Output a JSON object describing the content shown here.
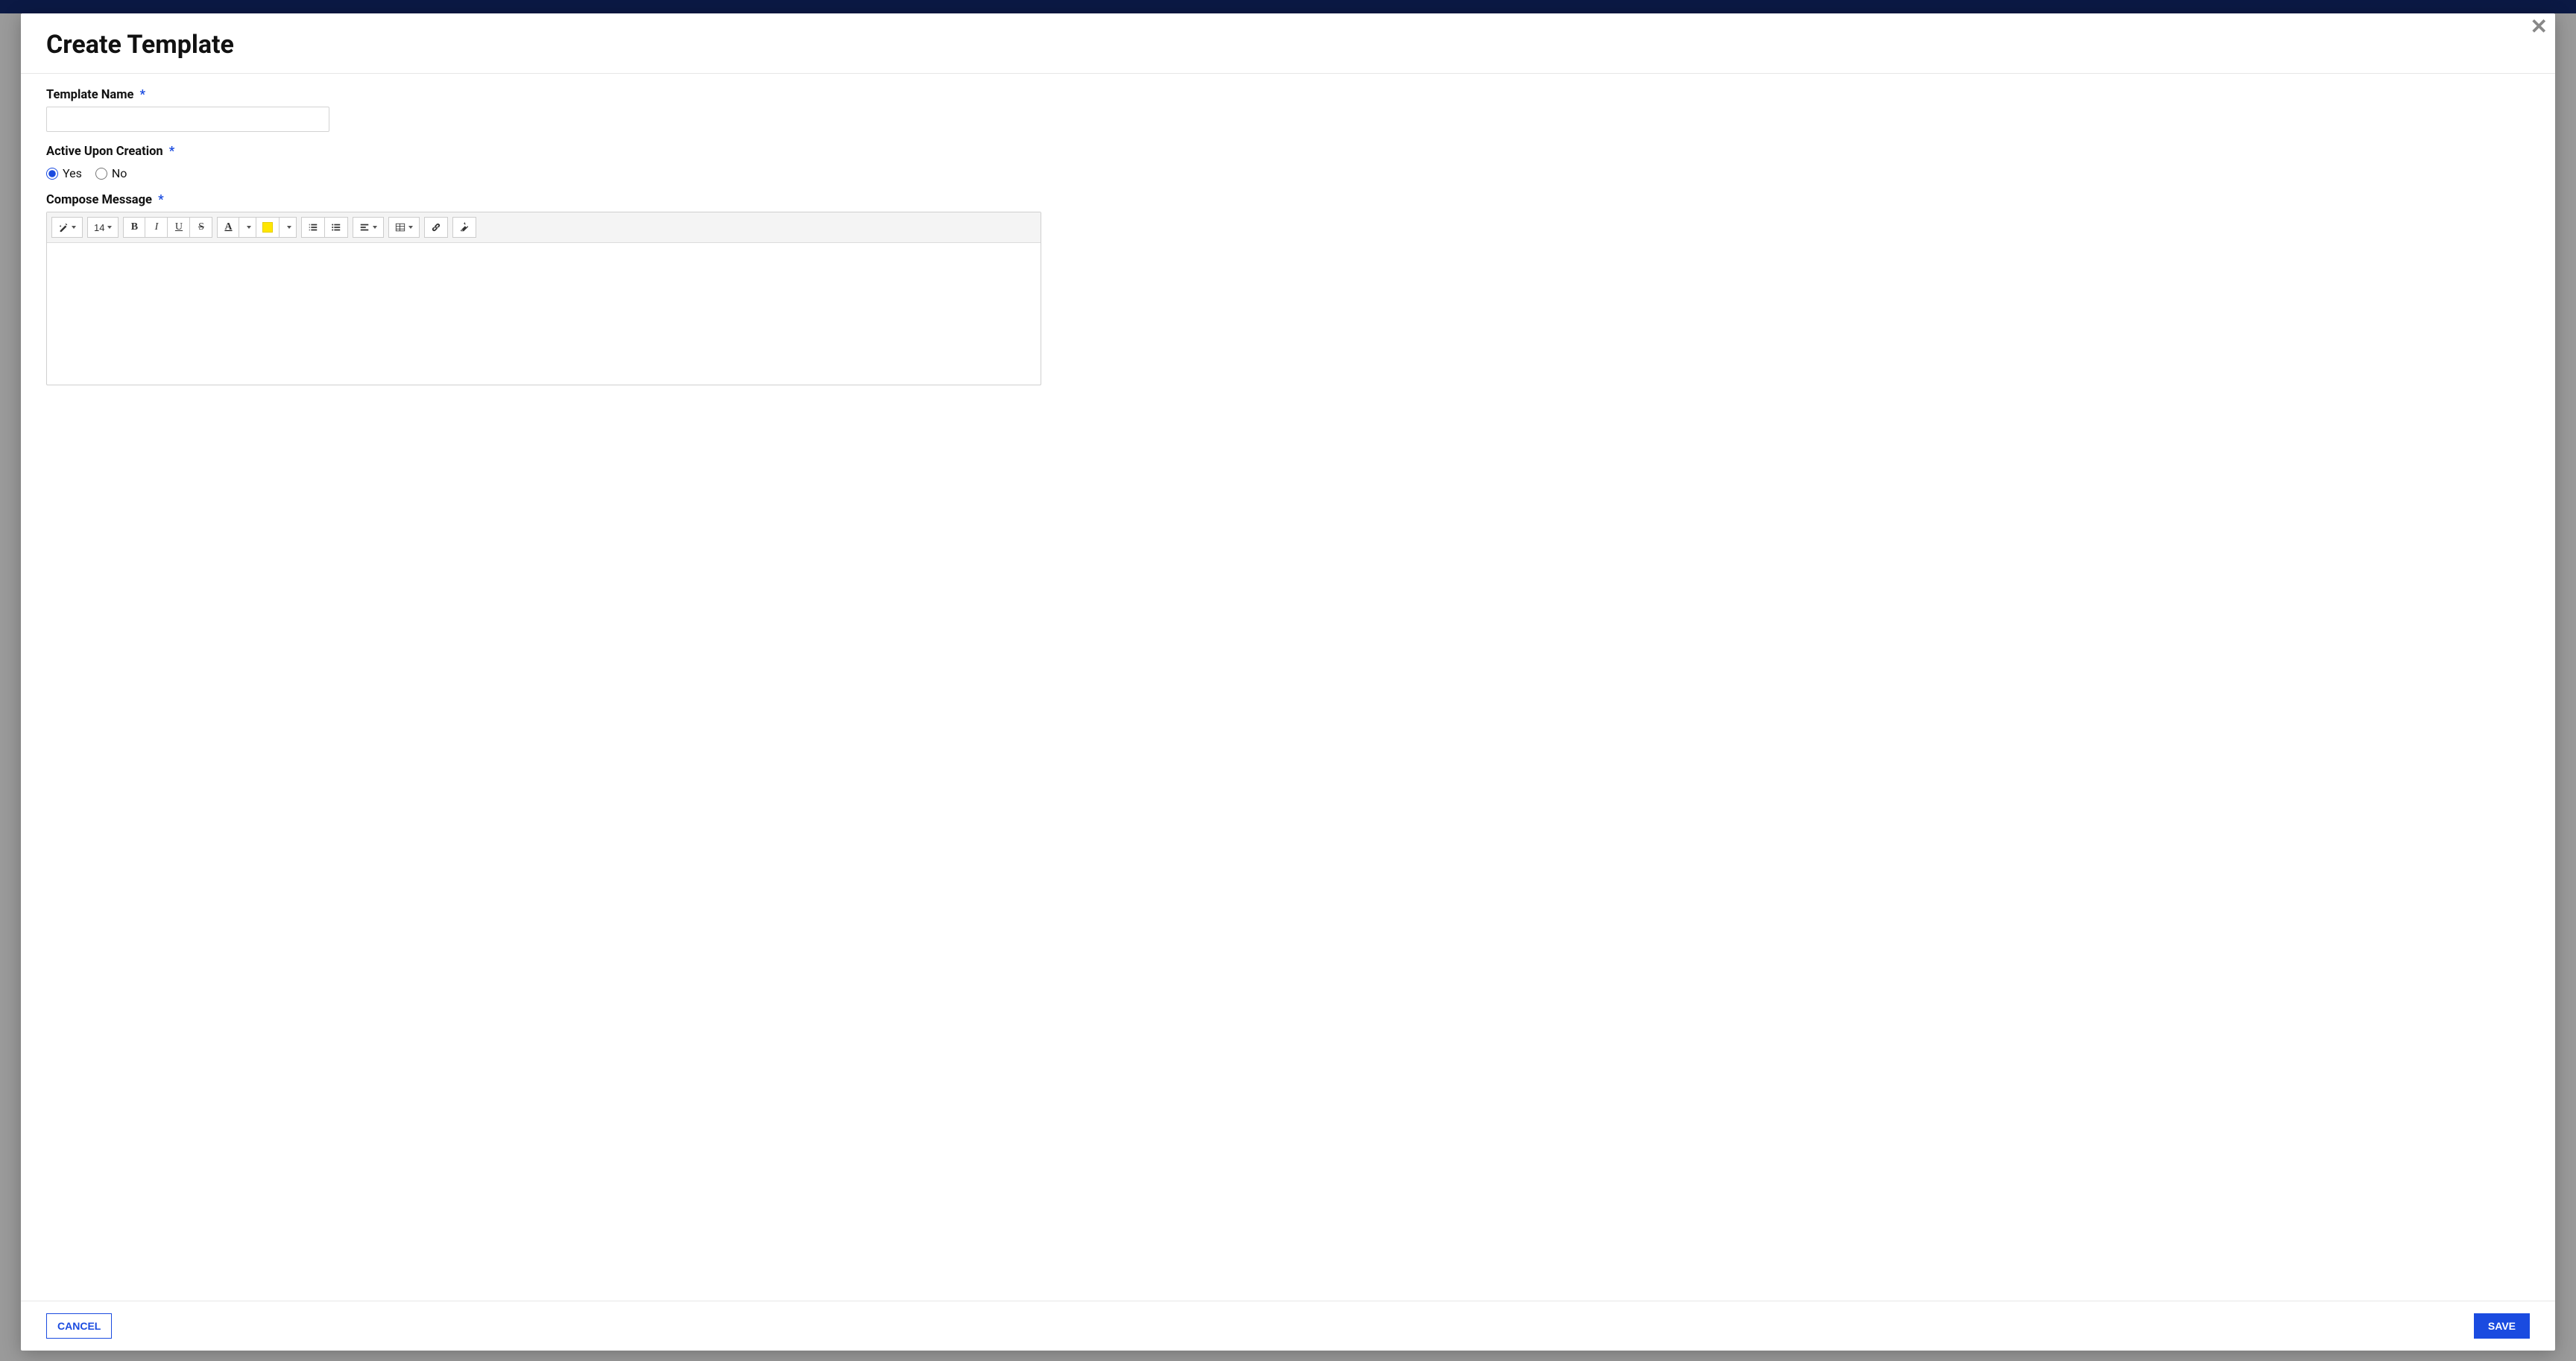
{
  "modal": {
    "title": "Create Template",
    "close_icon": "close-icon"
  },
  "fields": {
    "template_name": {
      "label": "Template Name",
      "required": "*",
      "value": ""
    },
    "active": {
      "label": "Active Upon Creation",
      "required": "*",
      "yes": "Yes",
      "no": "No",
      "selected": "yes"
    },
    "compose": {
      "label": "Compose Message",
      "required": "*",
      "content": ""
    }
  },
  "toolbar": {
    "font_size": "14",
    "highlight_color": "#ffe600"
  },
  "footer": {
    "cancel": "CANCEL",
    "save": "SAVE"
  }
}
